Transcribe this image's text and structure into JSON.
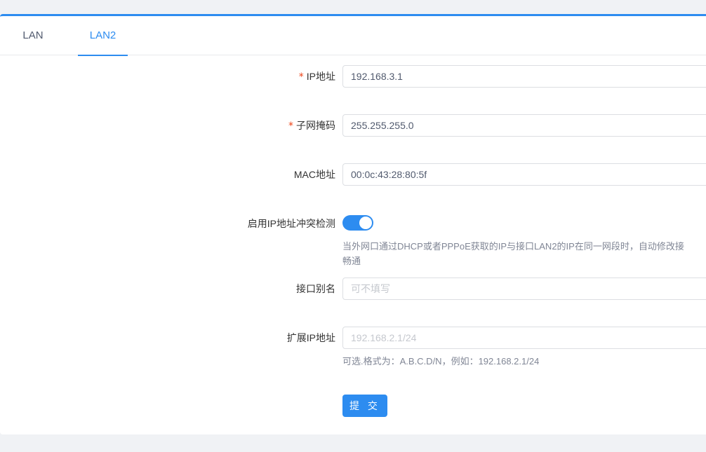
{
  "tabs": [
    {
      "label": "LAN",
      "active": false
    },
    {
      "label": "LAN2",
      "active": true
    }
  ],
  "form": {
    "ip": {
      "label": "IP地址",
      "required": true,
      "value": "192.168.3.1"
    },
    "mask": {
      "label": "子网掩码",
      "required": true,
      "value": "255.255.255.0"
    },
    "mac": {
      "label": "MAC地址",
      "value": "00:0c:43:28:80:5f"
    },
    "conflict": {
      "label": "启用IP地址冲突检测",
      "enabled": true,
      "help_line1": "当外网口通过DHCP或者PPPoE获取的IP与接口LAN2的IP在同一网段时，自动修改接",
      "help_line2": "畅通"
    },
    "alias": {
      "label": "接口别名",
      "value": "",
      "placeholder": "可不填写"
    },
    "ext_ip": {
      "label": "扩展IP地址",
      "value": "",
      "placeholder": "192.168.2.1/24",
      "help": "可选.格式为：A.B.C.D/N，例如：192.168.2.1/24"
    },
    "submit_label": "提 交",
    "required_mark": "*"
  },
  "colors": {
    "accent": "#2d8cf0",
    "required": "#ed4014",
    "background": "#f0f2f5"
  }
}
